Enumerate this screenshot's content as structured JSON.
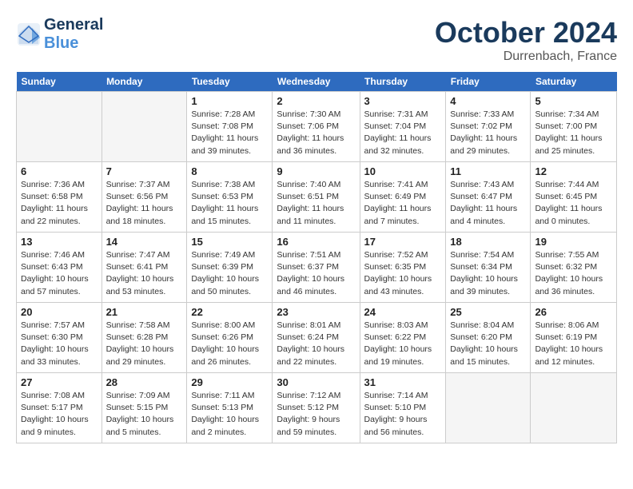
{
  "header": {
    "logo_general": "General",
    "logo_blue": "Blue",
    "month_year": "October 2024",
    "location": "Durrenbach, France"
  },
  "days_of_week": [
    "Sunday",
    "Monday",
    "Tuesday",
    "Wednesday",
    "Thursday",
    "Friday",
    "Saturday"
  ],
  "weeks": [
    [
      {
        "day": "",
        "sunrise": "",
        "sunset": "",
        "daylight": "",
        "empty": true
      },
      {
        "day": "",
        "sunrise": "",
        "sunset": "",
        "daylight": "",
        "empty": true
      },
      {
        "day": "1",
        "sunrise": "Sunrise: 7:28 AM",
        "sunset": "Sunset: 7:08 PM",
        "daylight": "Daylight: 11 hours and 39 minutes."
      },
      {
        "day": "2",
        "sunrise": "Sunrise: 7:30 AM",
        "sunset": "Sunset: 7:06 PM",
        "daylight": "Daylight: 11 hours and 36 minutes."
      },
      {
        "day": "3",
        "sunrise": "Sunrise: 7:31 AM",
        "sunset": "Sunset: 7:04 PM",
        "daylight": "Daylight: 11 hours and 32 minutes."
      },
      {
        "day": "4",
        "sunrise": "Sunrise: 7:33 AM",
        "sunset": "Sunset: 7:02 PM",
        "daylight": "Daylight: 11 hours and 29 minutes."
      },
      {
        "day": "5",
        "sunrise": "Sunrise: 7:34 AM",
        "sunset": "Sunset: 7:00 PM",
        "daylight": "Daylight: 11 hours and 25 minutes."
      }
    ],
    [
      {
        "day": "6",
        "sunrise": "Sunrise: 7:36 AM",
        "sunset": "Sunset: 6:58 PM",
        "daylight": "Daylight: 11 hours and 22 minutes."
      },
      {
        "day": "7",
        "sunrise": "Sunrise: 7:37 AM",
        "sunset": "Sunset: 6:56 PM",
        "daylight": "Daylight: 11 hours and 18 minutes."
      },
      {
        "day": "8",
        "sunrise": "Sunrise: 7:38 AM",
        "sunset": "Sunset: 6:53 PM",
        "daylight": "Daylight: 11 hours and 15 minutes."
      },
      {
        "day": "9",
        "sunrise": "Sunrise: 7:40 AM",
        "sunset": "Sunset: 6:51 PM",
        "daylight": "Daylight: 11 hours and 11 minutes."
      },
      {
        "day": "10",
        "sunrise": "Sunrise: 7:41 AM",
        "sunset": "Sunset: 6:49 PM",
        "daylight": "Daylight: 11 hours and 7 minutes."
      },
      {
        "day": "11",
        "sunrise": "Sunrise: 7:43 AM",
        "sunset": "Sunset: 6:47 PM",
        "daylight": "Daylight: 11 hours and 4 minutes."
      },
      {
        "day": "12",
        "sunrise": "Sunrise: 7:44 AM",
        "sunset": "Sunset: 6:45 PM",
        "daylight": "Daylight: 11 hours and 0 minutes."
      }
    ],
    [
      {
        "day": "13",
        "sunrise": "Sunrise: 7:46 AM",
        "sunset": "Sunset: 6:43 PM",
        "daylight": "Daylight: 10 hours and 57 minutes."
      },
      {
        "day": "14",
        "sunrise": "Sunrise: 7:47 AM",
        "sunset": "Sunset: 6:41 PM",
        "daylight": "Daylight: 10 hours and 53 minutes."
      },
      {
        "day": "15",
        "sunrise": "Sunrise: 7:49 AM",
        "sunset": "Sunset: 6:39 PM",
        "daylight": "Daylight: 10 hours and 50 minutes."
      },
      {
        "day": "16",
        "sunrise": "Sunrise: 7:51 AM",
        "sunset": "Sunset: 6:37 PM",
        "daylight": "Daylight: 10 hours and 46 minutes."
      },
      {
        "day": "17",
        "sunrise": "Sunrise: 7:52 AM",
        "sunset": "Sunset: 6:35 PM",
        "daylight": "Daylight: 10 hours and 43 minutes."
      },
      {
        "day": "18",
        "sunrise": "Sunrise: 7:54 AM",
        "sunset": "Sunset: 6:34 PM",
        "daylight": "Daylight: 10 hours and 39 minutes."
      },
      {
        "day": "19",
        "sunrise": "Sunrise: 7:55 AM",
        "sunset": "Sunset: 6:32 PM",
        "daylight": "Daylight: 10 hours and 36 minutes."
      }
    ],
    [
      {
        "day": "20",
        "sunrise": "Sunrise: 7:57 AM",
        "sunset": "Sunset: 6:30 PM",
        "daylight": "Daylight: 10 hours and 33 minutes."
      },
      {
        "day": "21",
        "sunrise": "Sunrise: 7:58 AM",
        "sunset": "Sunset: 6:28 PM",
        "daylight": "Daylight: 10 hours and 29 minutes."
      },
      {
        "day": "22",
        "sunrise": "Sunrise: 8:00 AM",
        "sunset": "Sunset: 6:26 PM",
        "daylight": "Daylight: 10 hours and 26 minutes."
      },
      {
        "day": "23",
        "sunrise": "Sunrise: 8:01 AM",
        "sunset": "Sunset: 6:24 PM",
        "daylight": "Daylight: 10 hours and 22 minutes."
      },
      {
        "day": "24",
        "sunrise": "Sunrise: 8:03 AM",
        "sunset": "Sunset: 6:22 PM",
        "daylight": "Daylight: 10 hours and 19 minutes."
      },
      {
        "day": "25",
        "sunrise": "Sunrise: 8:04 AM",
        "sunset": "Sunset: 6:20 PM",
        "daylight": "Daylight: 10 hours and 15 minutes."
      },
      {
        "day": "26",
        "sunrise": "Sunrise: 8:06 AM",
        "sunset": "Sunset: 6:19 PM",
        "daylight": "Daylight: 10 hours and 12 minutes."
      }
    ],
    [
      {
        "day": "27",
        "sunrise": "Sunrise: 7:08 AM",
        "sunset": "Sunset: 5:17 PM",
        "daylight": "Daylight: 10 hours and 9 minutes."
      },
      {
        "day": "28",
        "sunrise": "Sunrise: 7:09 AM",
        "sunset": "Sunset: 5:15 PM",
        "daylight": "Daylight: 10 hours and 5 minutes."
      },
      {
        "day": "29",
        "sunrise": "Sunrise: 7:11 AM",
        "sunset": "Sunset: 5:13 PM",
        "daylight": "Daylight: 10 hours and 2 minutes."
      },
      {
        "day": "30",
        "sunrise": "Sunrise: 7:12 AM",
        "sunset": "Sunset: 5:12 PM",
        "daylight": "Daylight: 9 hours and 59 minutes."
      },
      {
        "day": "31",
        "sunrise": "Sunrise: 7:14 AM",
        "sunset": "Sunset: 5:10 PM",
        "daylight": "Daylight: 9 hours and 56 minutes."
      },
      {
        "day": "",
        "sunrise": "",
        "sunset": "",
        "daylight": "",
        "empty": true
      },
      {
        "day": "",
        "sunrise": "",
        "sunset": "",
        "daylight": "",
        "empty": true
      }
    ]
  ]
}
